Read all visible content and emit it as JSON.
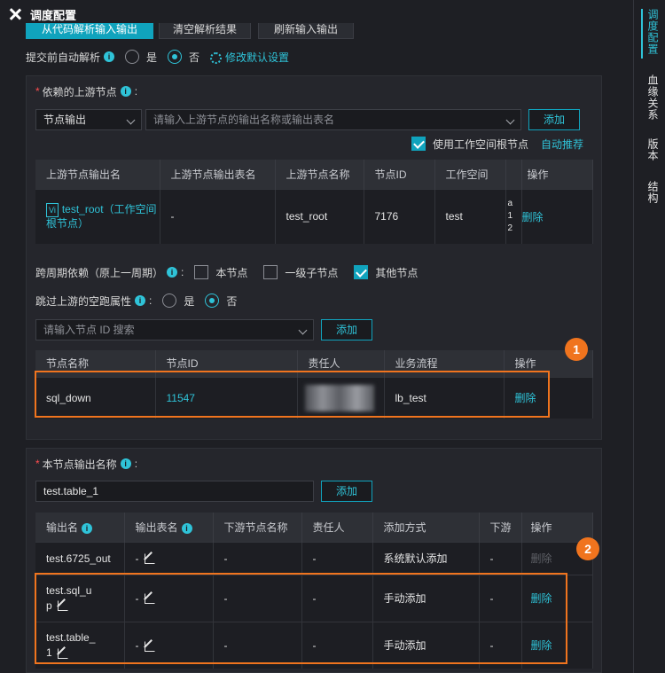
{
  "window": {
    "title": "调度配置"
  },
  "right_tabs": [
    "调度配置",
    "血缘关系",
    "版本",
    "结构"
  ],
  "top_buttons": [
    "从代码解析输入输出",
    "清空解析结果",
    "刷新输入输出"
  ],
  "auto_parse": {
    "label": "提交前自动解析",
    "yes": "是",
    "no": "否",
    "modify": "修改默认设置"
  },
  "upstream": {
    "label": "依赖的上游节点",
    "select_value": "节点输出",
    "search_placeholder": "请输入上游节点的输出名称或输出表名",
    "add": "添加",
    "use_root": "使用工作空间根节点",
    "auto_recommend": "自动推荐",
    "columns": [
      "上游节点输出名",
      "上游节点输出表名",
      "上游节点名称",
      "节点ID",
      "工作空间",
      "",
      "操作"
    ],
    "rows": [
      {
        "badge": "Vi",
        "output_name": "test_root（工作空间根节点）",
        "table_name": "-",
        "node_name": "test_root",
        "node_id": "7176",
        "workspace": "test",
        "extra": "a\n1\n2",
        "action": "删除"
      }
    ]
  },
  "cross_cycle": {
    "label": "跨周期依赖（原上一周期）",
    "opt1": "本节点",
    "opt2": "一级子节点",
    "opt3": "其他节点"
  },
  "skip_dry": {
    "label": "跳过上游的空跑属性",
    "yes": "是",
    "no": "否"
  },
  "other_nodes": {
    "search_placeholder": "请输入节点 ID 搜索",
    "add": "添加",
    "columns": [
      "节点名称",
      "节点ID",
      "责任人",
      "业务流程",
      "操作"
    ],
    "rows": [
      {
        "name": "sql_down",
        "id": "11547",
        "owner": "",
        "flow": "lb_test",
        "action": "删除"
      }
    ]
  },
  "output": {
    "label": "本节点输出名称",
    "input_value": "test.table_1",
    "add": "添加",
    "columns": [
      "输出名",
      "输出表名",
      "下游节点名称",
      "责任人",
      "添加方式",
      "下游",
      "操作"
    ],
    "rows": [
      {
        "name": "test.6725_out",
        "table": "-",
        "downstream": "-",
        "owner": "-",
        "method": "系统默认添加",
        "down2": "-",
        "action": "删除"
      },
      {
        "name": "test.sql_u p",
        "table": "-",
        "downstream": "-",
        "owner": "-",
        "method": "手动添加",
        "down2": "-",
        "action": "删除"
      },
      {
        "name": "test.table_ 1",
        "table": "-",
        "downstream": "-",
        "owner": "-",
        "method": "手动添加",
        "down2": "-",
        "action": "删除"
      }
    ]
  },
  "callouts": [
    "1",
    "2"
  ]
}
